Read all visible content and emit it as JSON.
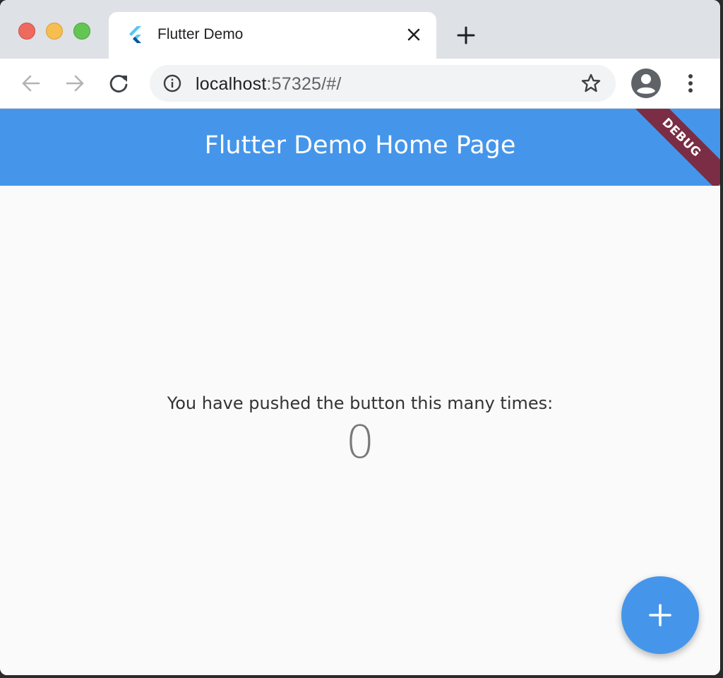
{
  "browser": {
    "tab": {
      "title": "Flutter Demo",
      "favicon": "flutter-logo-icon"
    },
    "toolbar": {
      "back_icon": "arrow-left-icon",
      "forward_icon": "arrow-right-icon",
      "reload_icon": "reload-icon",
      "site_info_icon": "info-icon",
      "bookmark_icon": "star-icon",
      "profile_icon": "account-circle-icon",
      "menu_icon": "kebab-menu-icon"
    },
    "omnibox": {
      "host": "localhost",
      "rest": ":57325/#/"
    }
  },
  "app": {
    "appbar_title": "Flutter Demo Home Page",
    "debug_banner": "DEBUG",
    "counter_label": "You have pushed the button this many times:",
    "counter_value": "0",
    "fab_icon": "plus-icon"
  },
  "colors": {
    "primary": "#4596ea",
    "debug_banner": "#7a2d45",
    "background": "#fafafa"
  }
}
